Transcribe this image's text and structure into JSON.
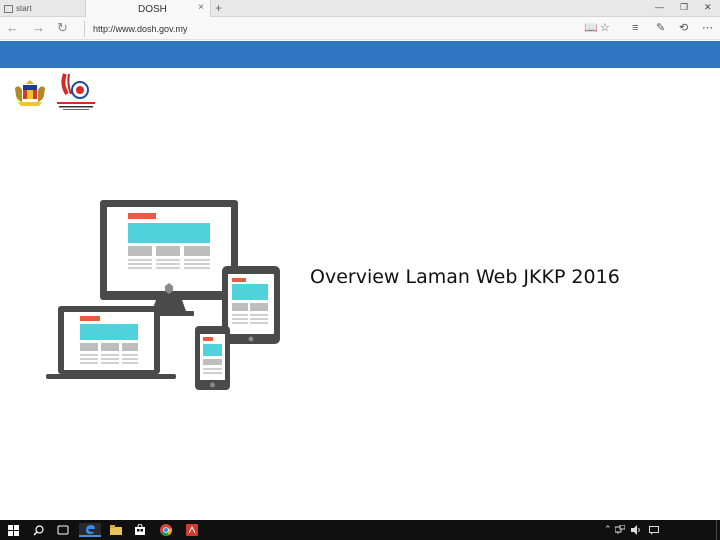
{
  "browser": {
    "start_tab_label": "start",
    "active_tab_title": "DOSH",
    "tab_close": "×",
    "new_tab": "+",
    "url": "http://www.dosh.gov.my",
    "window_controls": {
      "minimize": "—",
      "restore": "❐",
      "close": "✕"
    },
    "nav": {
      "back": "←",
      "forward": "→",
      "refresh": "↻"
    },
    "toolbar": {
      "reading_view": "📖",
      "favorite": "☆",
      "hub": "≡",
      "notes": "✎",
      "share": "⟲",
      "more": "⋯"
    }
  },
  "colors": {
    "brand_blue": "#2f77c3",
    "device_body": "#4a4a4a",
    "header_red": "#ea5a3e",
    "banner_cyan": "#4fd2dc",
    "block_gray": "#bdbdbd"
  },
  "page": {
    "headline": "Overview Laman Web JKKP 2016"
  },
  "logos": [
    "coat-of-arms-logo",
    "dosh-logo"
  ],
  "taskbar": {
    "items": [
      "start-icon",
      "search-icon",
      "task-view-icon",
      "edge-icon",
      "file-explorer-icon",
      "store-icon",
      "chrome-icon",
      "pdf-icon"
    ],
    "tray": [
      "chevron-up-icon",
      "network-icon",
      "volume-icon",
      "message-icon"
    ]
  }
}
